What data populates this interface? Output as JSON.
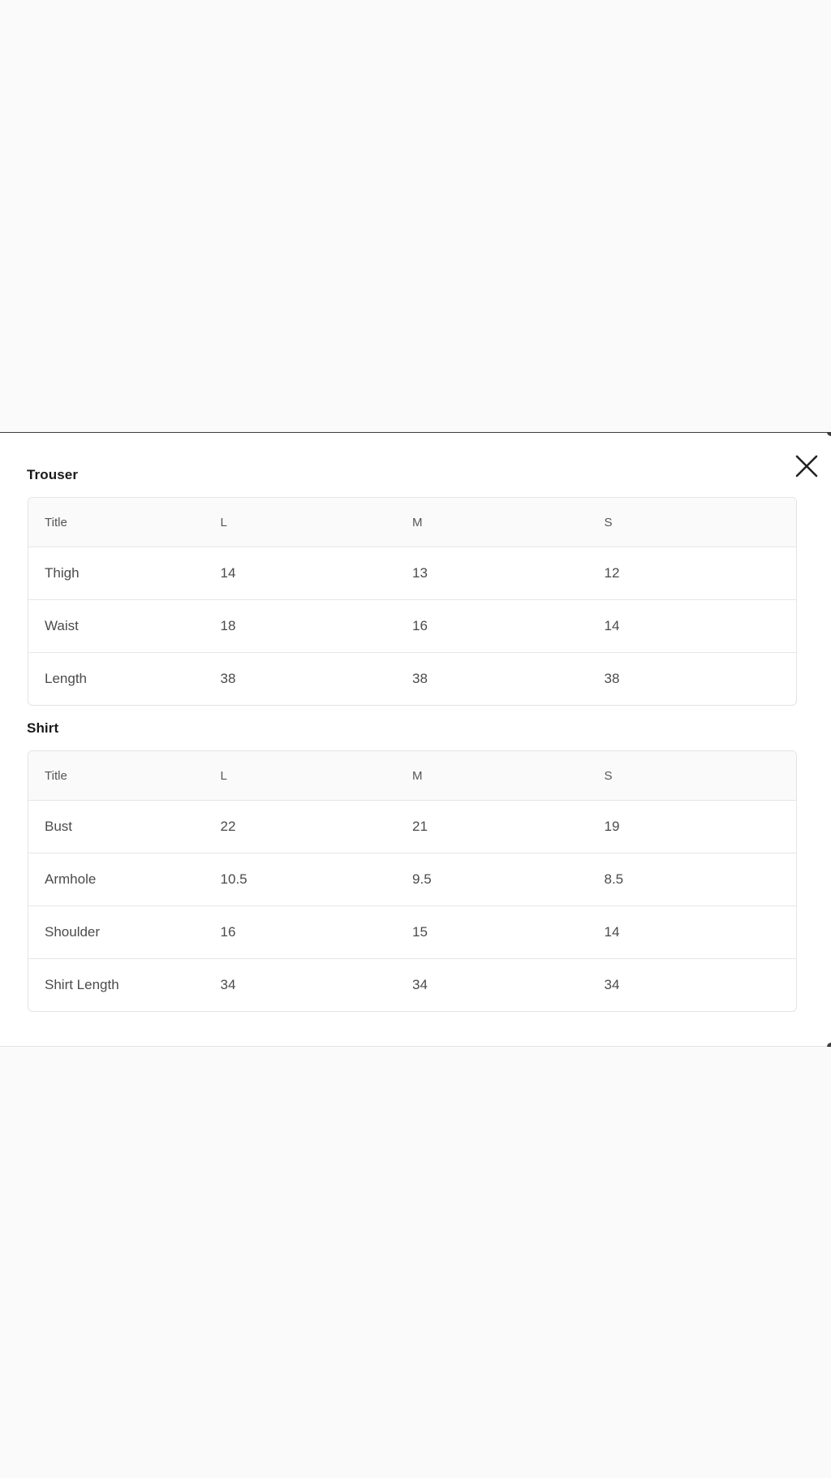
{
  "modal": {
    "close_label": "Close"
  },
  "sections": {
    "trouser": {
      "title": "Trouser",
      "headers": [
        "Title",
        "L",
        "M",
        "S"
      ],
      "rows": [
        [
          "Thigh",
          "14",
          "13",
          "12"
        ],
        [
          "Waist",
          "18",
          "16",
          "14"
        ],
        [
          "Length",
          "38",
          "38",
          "38"
        ]
      ]
    },
    "shirt": {
      "title": "Shirt",
      "headers": [
        "Title",
        "L",
        "M",
        "S"
      ],
      "rows": [
        [
          "Bust",
          "22",
          "21",
          "19"
        ],
        [
          "Armhole",
          "10.5",
          "9.5",
          "8.5"
        ],
        [
          "Shoulder",
          "16",
          "15",
          "14"
        ],
        [
          "Shirt Length",
          "34",
          "34",
          "34"
        ]
      ]
    }
  }
}
